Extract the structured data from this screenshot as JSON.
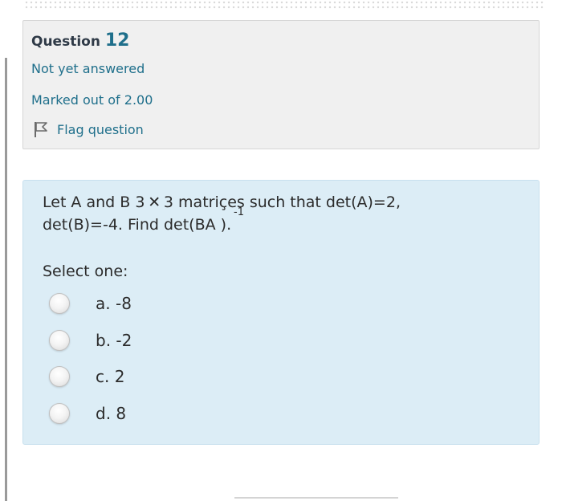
{
  "header": {
    "question_word": "Question",
    "question_number": "12",
    "status": "Not yet answered",
    "marks": "Marked out of 2.00",
    "flag_label": "Flag question"
  },
  "question": {
    "line1": "Let A and B 3 ✕ 3 matriçes such that det(A)=2,",
    "line2": "det(B)=-4. Find det(BA   ).",
    "superscript": "-1",
    "prompt": "Select one:"
  },
  "options": [
    {
      "label": "a. -8"
    },
    {
      "label": "b. -2"
    },
    {
      "label": "c. 2"
    },
    {
      "label": "d. 8"
    }
  ],
  "colors": {
    "accent": "#1f6f8b",
    "info_background": "#f0f0f0",
    "question_background": "#dcedf6"
  },
  "icons": {
    "flag": "flag-icon"
  }
}
